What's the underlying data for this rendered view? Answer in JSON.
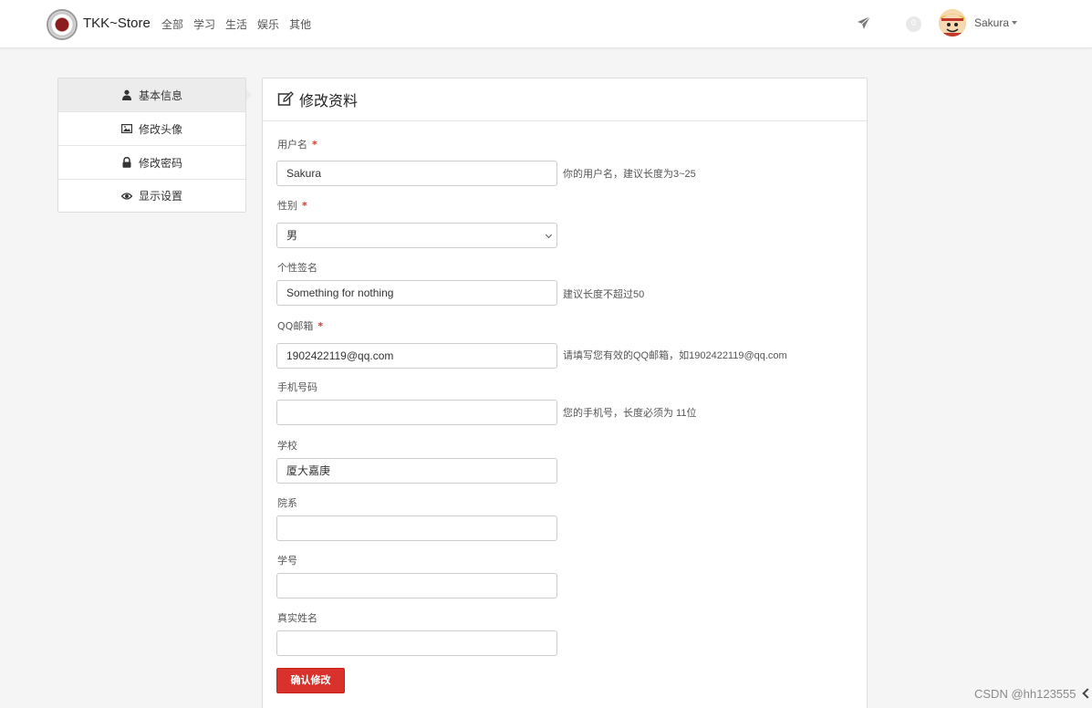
{
  "navbar": {
    "brand": "TKK~Store",
    "links": [
      "全部",
      "学习",
      "生活",
      "娱乐",
      "其他"
    ],
    "badge_count": "0",
    "username": "Sakura",
    "icons": {
      "send": "paper-plane-icon",
      "logo": "university-seal-logo",
      "avatar": "user-avatar"
    }
  },
  "sidebar": {
    "items": [
      {
        "label": "基本信息",
        "icon": "user-icon",
        "active": true
      },
      {
        "label": "修改头像",
        "icon": "image-icon",
        "active": false
      },
      {
        "label": "修改密码",
        "icon": "lock-icon",
        "active": false
      },
      {
        "label": "显示设置",
        "icon": "eye-icon",
        "active": false
      }
    ]
  },
  "panel": {
    "title": "修改资料",
    "title_icon": "edit-icon",
    "fields": {
      "username": {
        "label": "用户名",
        "required_mark": "*",
        "value": "Sakura",
        "help": "你的用户名，建议长度为3~25"
      },
      "gender": {
        "label": "性别",
        "required_mark": "*",
        "value": "男"
      },
      "signature": {
        "label": "个性签名",
        "value": "Something for nothing",
        "help": "建议长度不超过50"
      },
      "qq_email": {
        "label": "QQ邮箱",
        "required_mark": "*",
        "value": "1902422119@qq.com",
        "help": "请填写您有效的QQ邮箱，如1902422119@qq.com"
      },
      "phone": {
        "label": "手机号码",
        "value": "",
        "help": "您的手机号，长度必须为 11位"
      },
      "school": {
        "label": "学校",
        "value": "厦大嘉庚"
      },
      "department": {
        "label": "院系",
        "value": ""
      },
      "student_id": {
        "label": "学号",
        "value": ""
      },
      "real_name": {
        "label": "真实姓名",
        "value": ""
      }
    },
    "submit_label": "确认修改"
  },
  "watermark": "CSDN @hh123555",
  "colors": {
    "accent": "#d9312b",
    "required": "#d9312b",
    "active_item_bg": "#ececec"
  }
}
